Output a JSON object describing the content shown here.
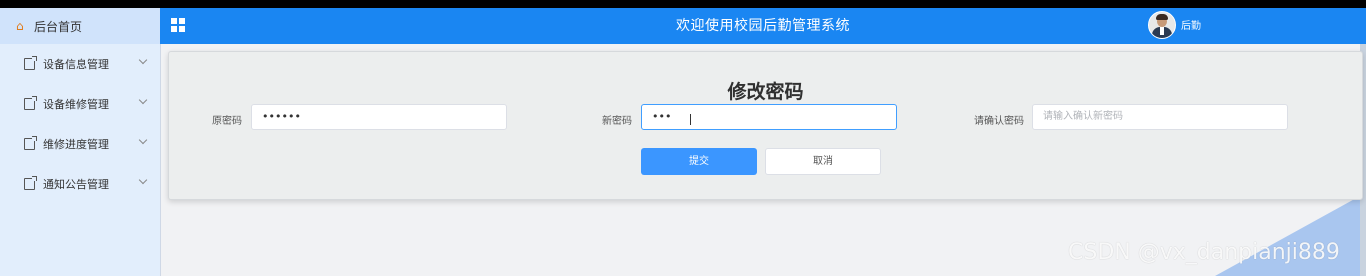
{
  "sidebar": {
    "home_label": "后台首页",
    "items": [
      {
        "label": "设备信息管理"
      },
      {
        "label": "设备维修管理"
      },
      {
        "label": "维修进度管理"
      },
      {
        "label": "通知公告管理"
      }
    ]
  },
  "header": {
    "title": "欢迎使用校园后勤管理系统",
    "user_name": "后勤"
  },
  "form": {
    "title": "修改密码",
    "old_password_label": "原密码",
    "old_password_value": "••••••",
    "new_password_label": "新密码",
    "new_password_value": "•••",
    "confirm_label": "请确认密码",
    "confirm_placeholder": "请输入确认新密码",
    "submit_label": "提交",
    "cancel_label": "取消"
  },
  "watermark": "CSDN @vx_danpianji889",
  "colors": {
    "header_bg": "#1a86f2",
    "sidebar_bg": "#e2eefc",
    "primary_button": "#3b96ff"
  }
}
